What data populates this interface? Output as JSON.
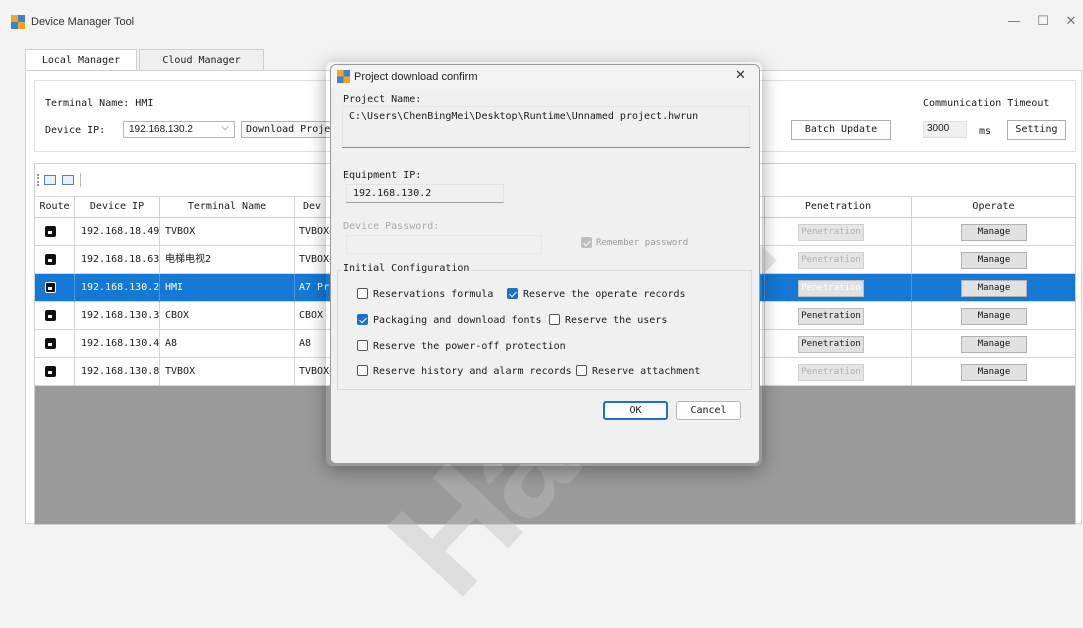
{
  "window": {
    "title": "Device Manager Tool",
    "min_icon": "—",
    "max_icon": "☐",
    "close_icon": "✕"
  },
  "tabs": [
    {
      "label": "Local Manager"
    },
    {
      "label": "Cloud Manager"
    }
  ],
  "toolbar": {
    "terminal_name": "Terminal Name: HMI",
    "device_ip_label": "Device IP:",
    "device_ip_value": "192.168.130.2",
    "download_label": "Download Project",
    "batch_update_label": "Batch Update",
    "timeout_label": "Communication Timeout",
    "timeout_value": "3000",
    "timeout_unit": "ms",
    "setting_label": "Setting"
  },
  "grid": {
    "columns": [
      "Route",
      "Device IP",
      "Terminal Name",
      "Dev",
      "Penetration",
      "Operate"
    ],
    "rows": [
      {
        "ip": "192.168.18.49",
        "name": "TVBOX",
        "dev": "TVBOX4",
        "penetration": "Penetration",
        "pen_enabled": false,
        "operate": "Manage",
        "selected": false
      },
      {
        "ip": "192.168.18.63",
        "name": "电梯电视2",
        "dev": "TVBOX4",
        "penetration": "Penetration",
        "pen_enabled": false,
        "operate": "Manage",
        "selected": false
      },
      {
        "ip": "192.168.130.2",
        "name": "HMI",
        "dev": "A7 Pr",
        "penetration": "Penetration",
        "pen_enabled": true,
        "operate": "Manage",
        "selected": true
      },
      {
        "ip": "192.168.130.3",
        "name": "CBOX",
        "dev": "CBOX",
        "penetration": "Penetration",
        "pen_enabled": true,
        "operate": "Manage",
        "selected": false
      },
      {
        "ip": "192.168.130.4",
        "name": "A8",
        "dev": "A8",
        "penetration": "Penetration",
        "pen_enabled": true,
        "operate": "Manage",
        "selected": false
      },
      {
        "ip": "192.168.130.8",
        "name": "TVBOX",
        "dev": "TVBOX4",
        "penetration": "Penetration",
        "pen_enabled": false,
        "operate": "Manage",
        "selected": false
      }
    ]
  },
  "dialog": {
    "title": "Project download confirm",
    "close_icon": "✕",
    "project_name_label": "Project Name:",
    "project_name_value": "C:\\Users\\ChenBingMei\\Desktop\\Runtime\\Unnamed project.hwrun",
    "equipment_ip_label": "Equipment IP:",
    "equipment_ip_value": "192.168.130.2",
    "device_password_label": "Device Password:",
    "remember_password_label": "Remember password",
    "initial_config_label": "Initial Configuration",
    "options": [
      {
        "label": "Reservations formula",
        "checked": false
      },
      {
        "label": "Reserve the operate records",
        "checked": true
      },
      {
        "label": "Packaging and download fonts",
        "checked": true
      },
      {
        "label": "Reserve the users",
        "checked": false
      },
      {
        "label": "Reserve the power-off protection",
        "checked": false
      },
      {
        "label": "Reserve history and alarm records",
        "checked": false
      },
      {
        "label": "Reserve attachment",
        "checked": false
      }
    ],
    "ok_label": "OK",
    "cancel_label": "Cancel"
  },
  "watermark": {
    "text": "Haiwell"
  },
  "colors": {
    "selection": "#1478d4",
    "accent": "#1a6fd0",
    "grid_empty": "#9a9a9a"
  }
}
